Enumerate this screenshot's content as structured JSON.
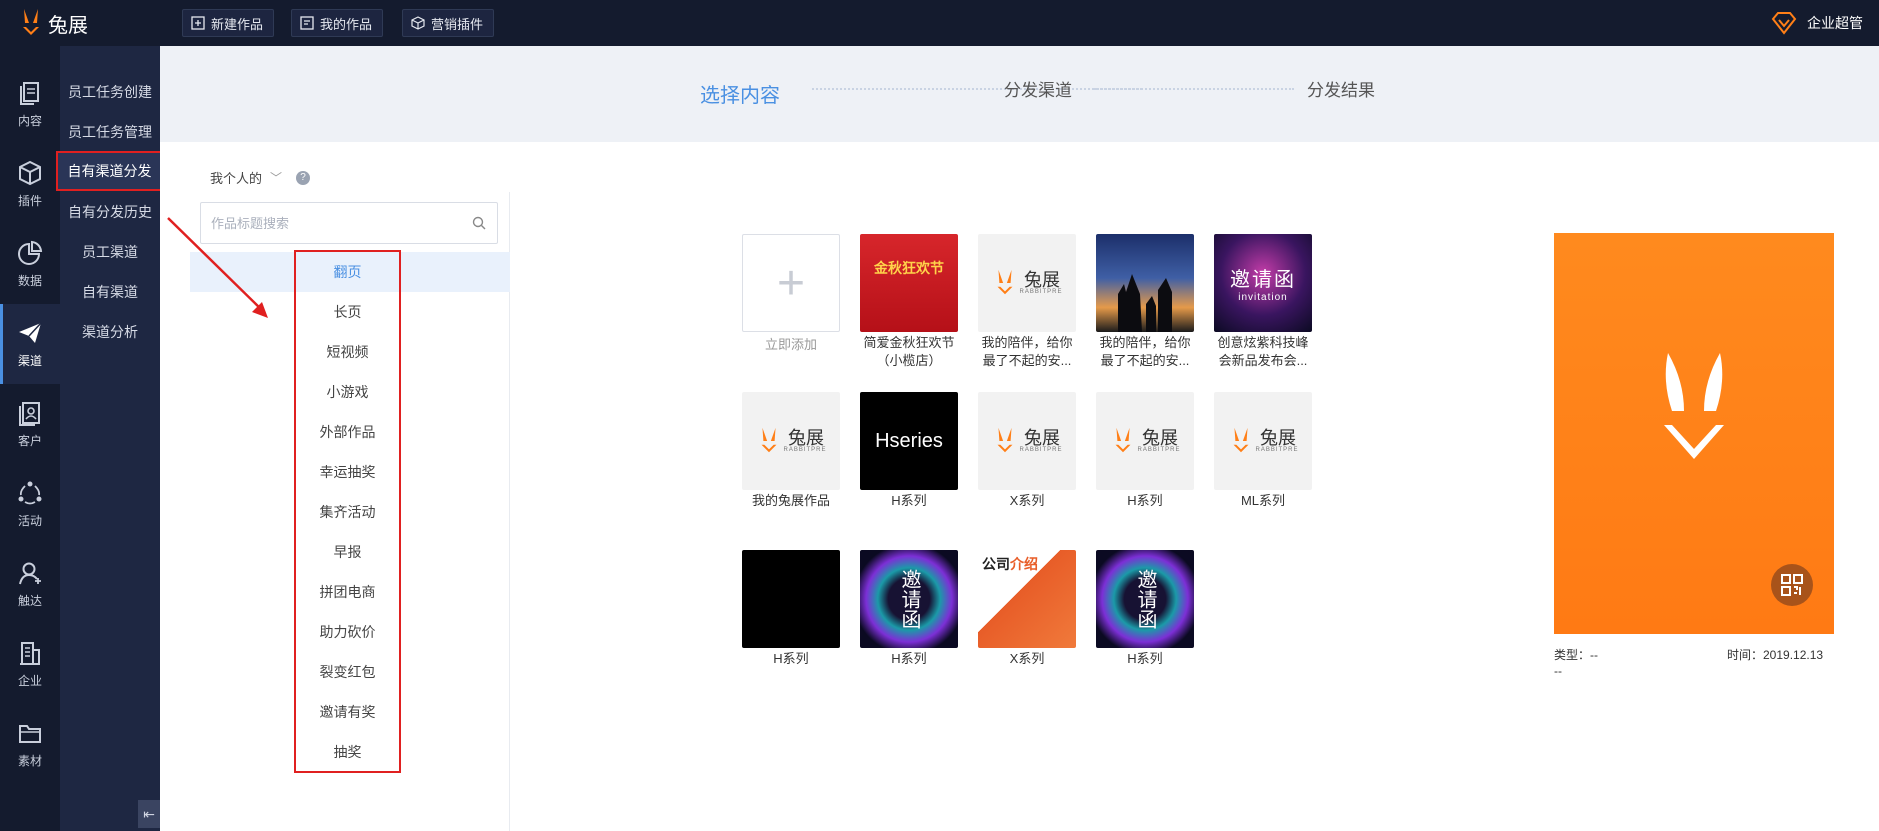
{
  "brand": {
    "name": "兔展"
  },
  "topbar": {
    "buttons": [
      {
        "label": "新建作品",
        "icon": "plus-square-icon"
      },
      {
        "label": "我的作品",
        "icon": "document-icon"
      },
      {
        "label": "营销插件",
        "icon": "cube-icon"
      }
    ],
    "user": {
      "label": "企业超管",
      "icon": "diamond-icon"
    }
  },
  "rail": {
    "items": [
      {
        "label": "内容",
        "icon": "pages-icon"
      },
      {
        "label": "插件",
        "icon": "cube-icon"
      },
      {
        "label": "数据",
        "icon": "pie-chart-icon"
      },
      {
        "label": "渠道",
        "icon": "paper-plane-icon",
        "active": true
      },
      {
        "label": "客户",
        "icon": "contact-card-icon"
      },
      {
        "label": "活动",
        "icon": "cycle-icon"
      },
      {
        "label": "触达",
        "icon": "user-icon"
      },
      {
        "label": "企业",
        "icon": "building-icon"
      },
      {
        "label": "素材",
        "icon": "folder-icon"
      }
    ]
  },
  "submenu": {
    "items": [
      "员工任务创建",
      "员工任务管理",
      "自有渠道分发",
      "自有分发历史",
      "员工渠道",
      "自有渠道",
      "渠道分析"
    ],
    "collapse_glyph": "⇤"
  },
  "steps": [
    "选择内容",
    "分发渠道",
    "分发结果"
  ],
  "scope": {
    "label": "我个人的",
    "chevron": "﹀",
    "help": "?"
  },
  "search": {
    "placeholder": "作品标题搜索"
  },
  "categories": [
    "翻页",
    "长页",
    "短视频",
    "小游戏",
    "外部作品",
    "幸运抽奖",
    "集齐活动",
    "早报",
    "拼团电商",
    "助力砍价",
    "裂变红包",
    "邀请有奖",
    "抽奖"
  ],
  "works": {
    "add_label": "立即添加",
    "items": [
      {
        "title": "简爱金秋狂欢节（小榄店）",
        "thumb_text": "金秋狂欢节"
      },
      {
        "title": "我的陪伴，给你最了不起的安..."
      },
      {
        "title": "我的陪伴，给你最了不起的安..."
      },
      {
        "title": "创意炫紫科技峰会新品发布会...",
        "thumb_big": "邀请函",
        "thumb_small": "invitation"
      },
      {
        "title": "我的兔展作品"
      },
      {
        "title": "H系列",
        "thumb_text": "Hseries"
      },
      {
        "title": "X系列"
      },
      {
        "title": "H系列"
      },
      {
        "title": "ML系列"
      },
      {
        "title": "H系列"
      },
      {
        "title": "H系列",
        "thumb_text": "邀请函"
      },
      {
        "title": "X系列",
        "thumb_text": "公司",
        "thumb_accent": "介绍"
      },
      {
        "title": "H系列",
        "thumb_text": "邀请函"
      }
    ],
    "brand_tile": {
      "name": "兔展",
      "sub": "RABBITPRE"
    }
  },
  "preview": {
    "type_label": "类型：--",
    "time_label": "时间：2019.12.13",
    "extra": "--"
  },
  "colors": {
    "accent": "#4a90e2",
    "brand_orange": "#ff7f17",
    "highlight_red": "#e02020",
    "nav_dark": "#141b2e"
  }
}
